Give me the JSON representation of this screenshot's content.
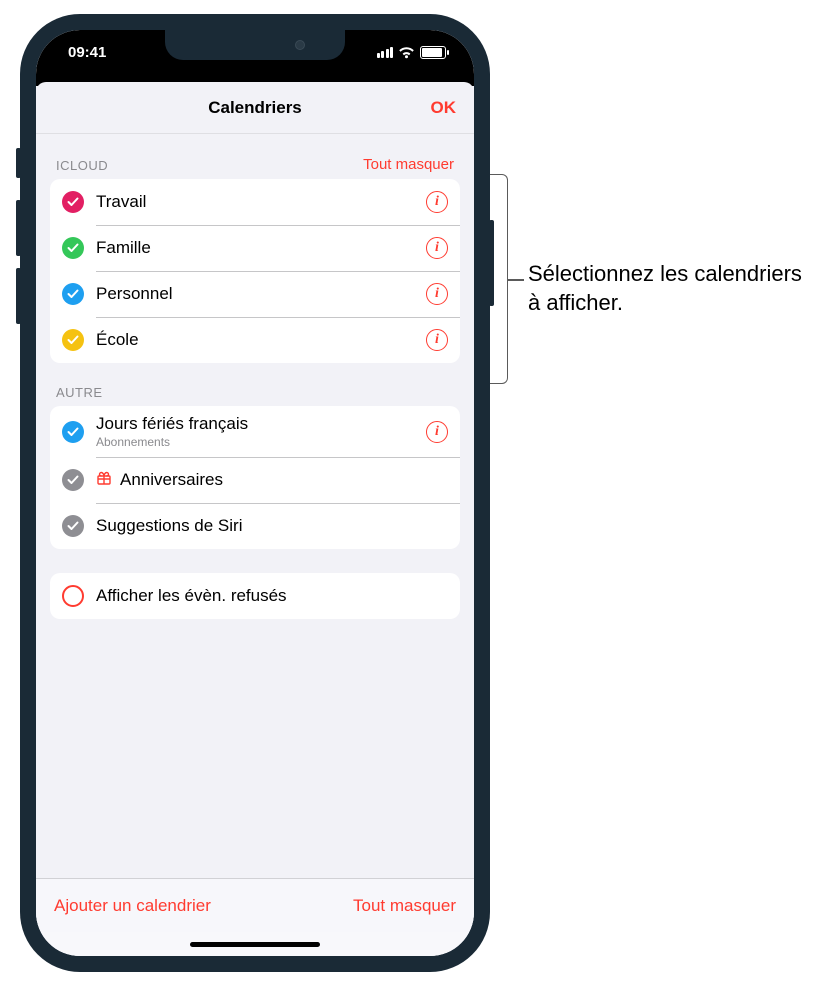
{
  "status_bar": {
    "time": "09:41"
  },
  "sheet": {
    "title": "Calendriers",
    "ok": "OK"
  },
  "sections": {
    "icloud": {
      "title": "ICLOUD",
      "hide_all": "Tout masquer",
      "items": [
        {
          "label": "Travail",
          "color": "#e21f63"
        },
        {
          "label": "Famille",
          "color": "#34c759"
        },
        {
          "label": "Personnel",
          "color": "#1e9ff0"
        },
        {
          "label": "École",
          "color": "#f5c211"
        }
      ]
    },
    "autre": {
      "title": "AUTRE",
      "items": [
        {
          "label": "Jours fériés français",
          "sub": "Abonnements",
          "color": "#1e9ff0",
          "checked": true,
          "info": true
        },
        {
          "label": "Anniversaires",
          "color": "#8e8e93",
          "checked": true,
          "birthday": true
        },
        {
          "label": "Suggestions de Siri",
          "color": "#8e8e93",
          "checked": true
        }
      ]
    },
    "declined": {
      "label": "Afficher les évèn. refusés",
      "color": "#ff3b30",
      "checked": false
    }
  },
  "bottom": {
    "add": "Ajouter un calendrier",
    "hide_all": "Tout masquer"
  },
  "callout": "Sélectionnez les calendriers à afficher."
}
